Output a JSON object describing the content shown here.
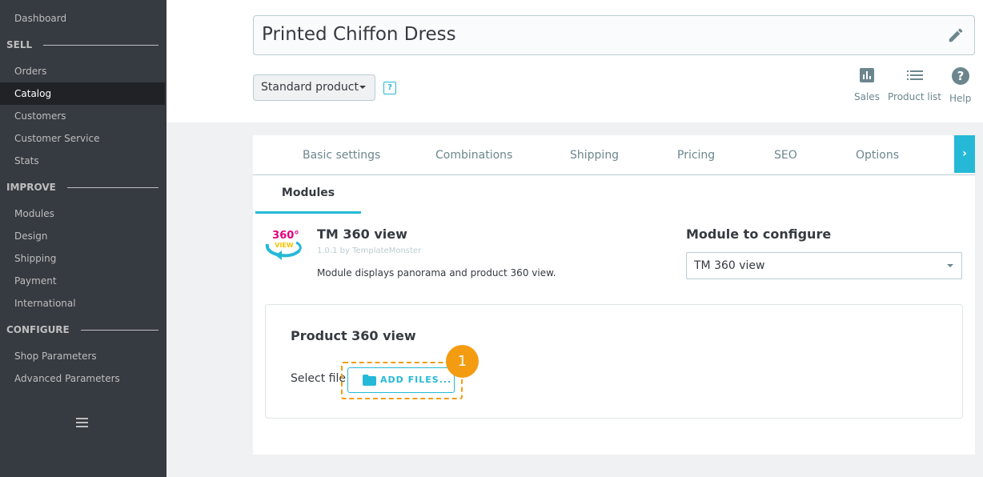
{
  "sidebar": {
    "dashboard": "Dashboard",
    "sell_section": "SELL",
    "orders": "Orders",
    "catalog": "Catalog",
    "customers": "Customers",
    "customer_service": "Customer Service",
    "stats": "Stats",
    "improve_section": "IMPROVE",
    "modules": "Modules",
    "design": "Design",
    "shipping": "Shipping",
    "payment": "Payment",
    "international": "International",
    "configure_section": "CONFIGURE",
    "shop_parameters": "Shop Parameters",
    "advanced_parameters": "Advanced Parameters",
    "collapse_icon": "menu-collapse-icon"
  },
  "header": {
    "product_name": "Printed Chiffon Dress",
    "product_type": "Standard product",
    "help_tooltip_icon": "?",
    "toolbar": {
      "sales": "Sales",
      "product_list": "Product list",
      "help": "Help"
    }
  },
  "tabs": {
    "items": [
      "Basic settings",
      "Combinations",
      "Shipping",
      "Pricing",
      "SEO",
      "Options"
    ],
    "next_icon": "›",
    "active_subtab": "Modules"
  },
  "module": {
    "logo_text_top": "360°",
    "logo_text_bottom": "VIEW",
    "name": "TM 360 view",
    "version": "1.0.1 by TemplateMonster",
    "description": "Module displays panorama and product 360 view.",
    "configure_label": "Module to configure",
    "configure_selected": "TM 360 view"
  },
  "panel": {
    "title": "Product 360 view",
    "select_file_label": "Select file",
    "add_files_label": "ADD FILES...",
    "step_number": "1"
  },
  "colors": {
    "accent": "#25b9d7",
    "highlight": "#f39c12",
    "sidebar_bg": "#363a41"
  }
}
